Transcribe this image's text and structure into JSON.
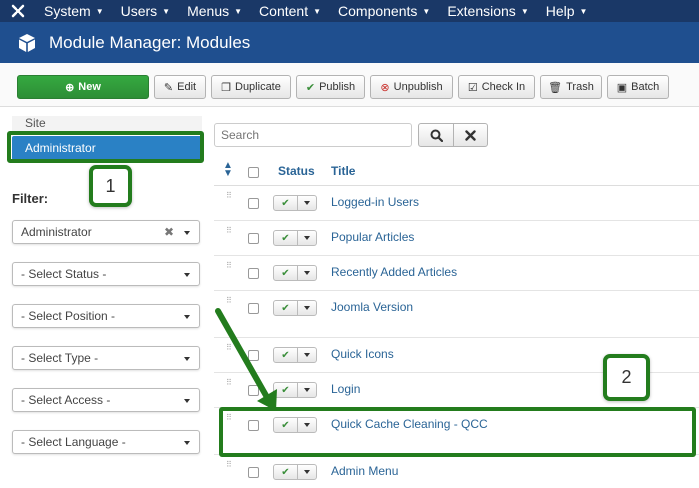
{
  "topnav": {
    "items": [
      {
        "label": "System"
      },
      {
        "label": "Users"
      },
      {
        "label": "Menus"
      },
      {
        "label": "Content"
      },
      {
        "label": "Components"
      },
      {
        "label": "Extensions"
      },
      {
        "label": "Help"
      }
    ]
  },
  "header": {
    "title": "Module Manager: Modules"
  },
  "toolbar": {
    "new": "New",
    "edit": "Edit",
    "duplicate": "Duplicate",
    "publish": "Publish",
    "unpublish": "Unpublish",
    "checkin": "Check In",
    "trash": "Trash",
    "batch": "Batch"
  },
  "sidebar": {
    "site": "Site",
    "administrator": "Administrator",
    "filter_label": "Filter:",
    "filters": [
      {
        "value": "Administrator"
      },
      {
        "value": "- Select Status -"
      },
      {
        "value": "- Select Position -"
      },
      {
        "value": "- Select Type -"
      },
      {
        "value": "- Select Access -"
      },
      {
        "value": "- Select Language -"
      }
    ]
  },
  "search": {
    "placeholder": "Search"
  },
  "table": {
    "col_status": "Status",
    "col_title": "Title",
    "rows": [
      {
        "title": "Logged-in Users"
      },
      {
        "title": "Popular Articles"
      },
      {
        "title": "Recently Added Articles"
      },
      {
        "title": "Joomla Version"
      },
      {
        "title": "Quick Icons"
      },
      {
        "title": "Login"
      },
      {
        "title": "Quick Cache Cleaning - QCC"
      },
      {
        "title": "Admin Menu"
      }
    ]
  },
  "annotations": {
    "badge1": "1",
    "badge2": "2",
    "color": "#237c1d"
  }
}
